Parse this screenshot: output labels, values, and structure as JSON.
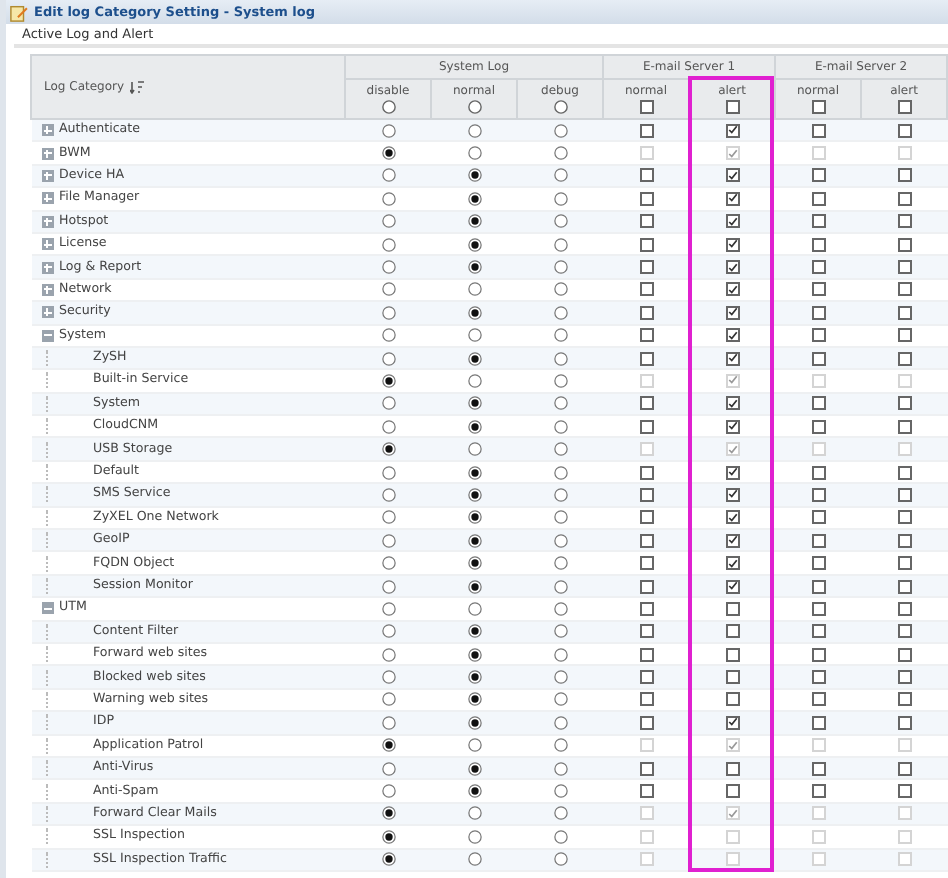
{
  "window": {
    "title": "Edit log Category Setting - System log"
  },
  "section": {
    "title": "Active Log and Alert"
  },
  "table": {
    "category_header": "Log Category",
    "groups": [
      {
        "title": "System Log",
        "columns": [
          {
            "label": "disable",
            "kind": "radio",
            "selected": false
          },
          {
            "label": "normal",
            "kind": "radio",
            "selected": false
          },
          {
            "label": "debug",
            "kind": "radio",
            "selected": false
          }
        ]
      },
      {
        "title": "E-mail Server 1",
        "columns": [
          {
            "label": "normal",
            "kind": "checkbox",
            "checked": false,
            "highlighted": false
          },
          {
            "label": "alert",
            "kind": "checkbox",
            "checked": false,
            "highlighted": true
          }
        ]
      },
      {
        "title": "E-mail Server 2",
        "columns": [
          {
            "label": "normal",
            "kind": "checkbox",
            "checked": false,
            "highlighted": false
          },
          {
            "label": "alert",
            "kind": "checkbox",
            "checked": false,
            "highlighted": false
          }
        ]
      }
    ],
    "rows": [
      {
        "label": "Authenticate",
        "expanded": false,
        "disabled": false,
        "system_log": [
          {
            "selected": false
          },
          {
            "selected": false
          },
          {
            "selected": false
          }
        ],
        "email": [
          {
            "checked": false
          },
          {
            "checked": true
          },
          {
            "checked": false
          },
          {
            "checked": false
          }
        ]
      },
      {
        "label": "BWM",
        "expanded": false,
        "disabled": true,
        "system_log": [
          {
            "selected": true
          },
          {
            "selected": false
          },
          {
            "selected": false
          }
        ],
        "email": [
          {
            "checked": false
          },
          {
            "checked": true
          },
          {
            "checked": false
          },
          {
            "checked": false
          }
        ]
      },
      {
        "label": "Device HA",
        "expanded": false,
        "disabled": false,
        "system_log": [
          {
            "selected": false
          },
          {
            "selected": true
          },
          {
            "selected": false
          }
        ],
        "email": [
          {
            "checked": false
          },
          {
            "checked": true
          },
          {
            "checked": false
          },
          {
            "checked": false
          }
        ]
      },
      {
        "label": "File Manager",
        "expanded": false,
        "disabled": false,
        "system_log": [
          {
            "selected": false
          },
          {
            "selected": true
          },
          {
            "selected": false
          }
        ],
        "email": [
          {
            "checked": false
          },
          {
            "checked": true
          },
          {
            "checked": false
          },
          {
            "checked": false
          }
        ]
      },
      {
        "label": "Hotspot",
        "expanded": false,
        "disabled": false,
        "system_log": [
          {
            "selected": false
          },
          {
            "selected": true
          },
          {
            "selected": false
          }
        ],
        "email": [
          {
            "checked": false
          },
          {
            "checked": true
          },
          {
            "checked": false
          },
          {
            "checked": false
          }
        ]
      },
      {
        "label": "License",
        "expanded": false,
        "disabled": false,
        "system_log": [
          {
            "selected": false
          },
          {
            "selected": true
          },
          {
            "selected": false
          }
        ],
        "email": [
          {
            "checked": false
          },
          {
            "checked": true
          },
          {
            "checked": false
          },
          {
            "checked": false
          }
        ]
      },
      {
        "label": "Log & Report",
        "expanded": false,
        "disabled": false,
        "system_log": [
          {
            "selected": false
          },
          {
            "selected": true
          },
          {
            "selected": false
          }
        ],
        "email": [
          {
            "checked": false
          },
          {
            "checked": true
          },
          {
            "checked": false
          },
          {
            "checked": false
          }
        ]
      },
      {
        "label": "Network",
        "expanded": false,
        "disabled": false,
        "system_log": [
          {
            "selected": false
          },
          {
            "selected": false
          },
          {
            "selected": false
          }
        ],
        "email": [
          {
            "checked": false
          },
          {
            "checked": true
          },
          {
            "checked": false
          },
          {
            "checked": false
          }
        ]
      },
      {
        "label": "Security",
        "expanded": false,
        "disabled": false,
        "system_log": [
          {
            "selected": false
          },
          {
            "selected": true
          },
          {
            "selected": false
          }
        ],
        "email": [
          {
            "checked": false
          },
          {
            "checked": true
          },
          {
            "checked": false
          },
          {
            "checked": false
          }
        ]
      },
      {
        "label": "System",
        "expanded": true,
        "disabled": false,
        "system_log": [
          {
            "selected": false
          },
          {
            "selected": false
          },
          {
            "selected": false
          }
        ],
        "email": [
          {
            "checked": false
          },
          {
            "checked": true
          },
          {
            "checked": false
          },
          {
            "checked": false
          }
        ],
        "children": [
          {
            "label": "ZySH",
            "disabled": false,
            "system_log": [
              {
                "selected": false
              },
              {
                "selected": true
              },
              {
                "selected": false
              }
            ],
            "email": [
              {
                "checked": false
              },
              {
                "checked": true
              },
              {
                "checked": false
              },
              {
                "checked": false
              }
            ]
          },
          {
            "label": "Built-in Service",
            "disabled": true,
            "system_log": [
              {
                "selected": true
              },
              {
                "selected": false
              },
              {
                "selected": false
              }
            ],
            "email": [
              {
                "checked": false
              },
              {
                "checked": true
              },
              {
                "checked": false
              },
              {
                "checked": false
              }
            ]
          },
          {
            "label": "System",
            "disabled": false,
            "system_log": [
              {
                "selected": false
              },
              {
                "selected": true
              },
              {
                "selected": false
              }
            ],
            "email": [
              {
                "checked": false
              },
              {
                "checked": true
              },
              {
                "checked": false
              },
              {
                "checked": false
              }
            ]
          },
          {
            "label": "CloudCNM",
            "disabled": false,
            "system_log": [
              {
                "selected": false
              },
              {
                "selected": true
              },
              {
                "selected": false
              }
            ],
            "email": [
              {
                "checked": false
              },
              {
                "checked": true
              },
              {
                "checked": false
              },
              {
                "checked": false
              }
            ]
          },
          {
            "label": "USB Storage",
            "disabled": true,
            "system_log": [
              {
                "selected": true
              },
              {
                "selected": false
              },
              {
                "selected": false
              }
            ],
            "email": [
              {
                "checked": false
              },
              {
                "checked": true
              },
              {
                "checked": false
              },
              {
                "checked": false
              }
            ]
          },
          {
            "label": "Default",
            "disabled": false,
            "system_log": [
              {
                "selected": false
              },
              {
                "selected": true
              },
              {
                "selected": false
              }
            ],
            "email": [
              {
                "checked": false
              },
              {
                "checked": true
              },
              {
                "checked": false
              },
              {
                "checked": false
              }
            ]
          },
          {
            "label": "SMS Service",
            "disabled": false,
            "system_log": [
              {
                "selected": false
              },
              {
                "selected": true
              },
              {
                "selected": false
              }
            ],
            "email": [
              {
                "checked": false
              },
              {
                "checked": true
              },
              {
                "checked": false
              },
              {
                "checked": false
              }
            ]
          },
          {
            "label": "ZyXEL One Network",
            "disabled": false,
            "system_log": [
              {
                "selected": false
              },
              {
                "selected": true
              },
              {
                "selected": false
              }
            ],
            "email": [
              {
                "checked": false
              },
              {
                "checked": true
              },
              {
                "checked": false
              },
              {
                "checked": false
              }
            ]
          },
          {
            "label": "GeoIP",
            "disabled": false,
            "system_log": [
              {
                "selected": false
              },
              {
                "selected": true
              },
              {
                "selected": false
              }
            ],
            "email": [
              {
                "checked": false
              },
              {
                "checked": true
              },
              {
                "checked": false
              },
              {
                "checked": false
              }
            ]
          },
          {
            "label": "FQDN Object",
            "disabled": false,
            "system_log": [
              {
                "selected": false
              },
              {
                "selected": true
              },
              {
                "selected": false
              }
            ],
            "email": [
              {
                "checked": false
              },
              {
                "checked": true
              },
              {
                "checked": false
              },
              {
                "checked": false
              }
            ]
          },
          {
            "label": "Session Monitor",
            "disabled": false,
            "system_log": [
              {
                "selected": false
              },
              {
                "selected": true
              },
              {
                "selected": false
              }
            ],
            "email": [
              {
                "checked": false
              },
              {
                "checked": true
              },
              {
                "checked": false
              },
              {
                "checked": false
              }
            ]
          }
        ]
      },
      {
        "label": "UTM",
        "expanded": true,
        "disabled": false,
        "system_log": [
          {
            "selected": false
          },
          {
            "selected": false
          },
          {
            "selected": false
          }
        ],
        "email": [
          {
            "checked": false
          },
          {
            "checked": false
          },
          {
            "checked": false
          },
          {
            "checked": false
          }
        ],
        "children": [
          {
            "label": "Content Filter",
            "disabled": false,
            "system_log": [
              {
                "selected": false
              },
              {
                "selected": true
              },
              {
                "selected": false
              }
            ],
            "email": [
              {
                "checked": false
              },
              {
                "checked": false
              },
              {
                "checked": false
              },
              {
                "checked": false
              }
            ]
          },
          {
            "label": "Forward web sites",
            "disabled": false,
            "system_log": [
              {
                "selected": false
              },
              {
                "selected": true
              },
              {
                "selected": false
              }
            ],
            "email": [
              {
                "checked": false
              },
              {
                "checked": false
              },
              {
                "checked": false
              },
              {
                "checked": false
              }
            ]
          },
          {
            "label": "Blocked web sites",
            "disabled": false,
            "system_log": [
              {
                "selected": false
              },
              {
                "selected": true
              },
              {
                "selected": false
              }
            ],
            "email": [
              {
                "checked": false
              },
              {
                "checked": false
              },
              {
                "checked": false
              },
              {
                "checked": false
              }
            ]
          },
          {
            "label": "Warning web sites",
            "disabled": false,
            "system_log": [
              {
                "selected": false
              },
              {
                "selected": true
              },
              {
                "selected": false
              }
            ],
            "email": [
              {
                "checked": false
              },
              {
                "checked": false
              },
              {
                "checked": false
              },
              {
                "checked": false
              }
            ]
          },
          {
            "label": "IDP",
            "disabled": false,
            "system_log": [
              {
                "selected": false
              },
              {
                "selected": true
              },
              {
                "selected": false
              }
            ],
            "email": [
              {
                "checked": false
              },
              {
                "checked": true
              },
              {
                "checked": false
              },
              {
                "checked": false
              }
            ]
          },
          {
            "label": "Application Patrol",
            "disabled": true,
            "system_log": [
              {
                "selected": true
              },
              {
                "selected": false
              },
              {
                "selected": false
              }
            ],
            "email": [
              {
                "checked": false
              },
              {
                "checked": true
              },
              {
                "checked": false
              },
              {
                "checked": false
              }
            ]
          },
          {
            "label": "Anti-Virus",
            "disabled": false,
            "system_log": [
              {
                "selected": false
              },
              {
                "selected": true
              },
              {
                "selected": false
              }
            ],
            "email": [
              {
                "checked": false
              },
              {
                "checked": false
              },
              {
                "checked": false
              },
              {
                "checked": false
              }
            ]
          },
          {
            "label": "Anti-Spam",
            "disabled": false,
            "system_log": [
              {
                "selected": false
              },
              {
                "selected": true
              },
              {
                "selected": false
              }
            ],
            "email": [
              {
                "checked": false
              },
              {
                "checked": false
              },
              {
                "checked": false
              },
              {
                "checked": false
              }
            ]
          },
          {
            "label": "Forward Clear Mails",
            "disabled": true,
            "system_log": [
              {
                "selected": true
              },
              {
                "selected": false
              },
              {
                "selected": false
              }
            ],
            "email": [
              {
                "checked": false
              },
              {
                "checked": true
              },
              {
                "checked": false
              },
              {
                "checked": false
              }
            ]
          },
          {
            "label": "SSL Inspection",
            "disabled": true,
            "system_log": [
              {
                "selected": true
              },
              {
                "selected": false
              },
              {
                "selected": false
              }
            ],
            "email": [
              {
                "checked": false
              },
              {
                "checked": false
              },
              {
                "checked": false
              },
              {
                "checked": false
              }
            ]
          },
          {
            "label": "SSL Inspection Traffic",
            "disabled": true,
            "system_log": [
              {
                "selected": true
              },
              {
                "selected": false
              },
              {
                "selected": false
              }
            ],
            "email": [
              {
                "checked": false
              },
              {
                "checked": false
              },
              {
                "checked": false
              },
              {
                "checked": false
              }
            ]
          }
        ]
      }
    ]
  }
}
